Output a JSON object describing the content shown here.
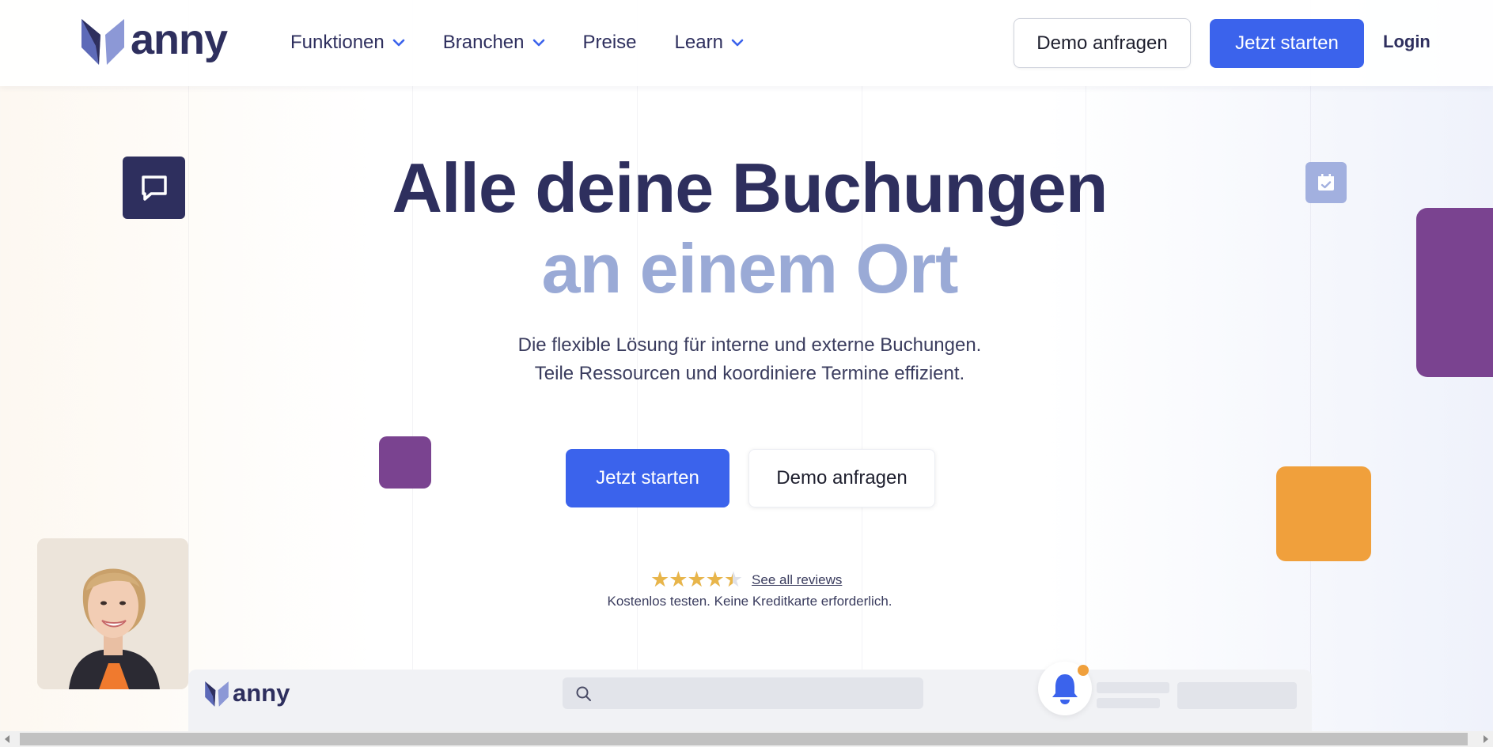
{
  "header": {
    "logo_text": "anny",
    "nav": [
      {
        "label": "Funktionen",
        "has_dropdown": true
      },
      {
        "label": "Branchen",
        "has_dropdown": true
      },
      {
        "label": "Preise",
        "has_dropdown": false
      },
      {
        "label": "Learn",
        "has_dropdown": true
      }
    ],
    "demo_label": "Demo anfragen",
    "start_label": "Jetzt starten",
    "login_label": "Login"
  },
  "hero": {
    "title_line1": "Alle deine Buchungen",
    "title_line2": "an einem Ort",
    "subtitle_line1": "Die flexible Lösung für interne und externe Buchungen.",
    "subtitle_line2": "Teile Ressourcen und koordiniere Termine effizient.",
    "primary_cta": "Jetzt starten",
    "secondary_cta": "Demo anfragen",
    "rating": {
      "stars_glyphs": "★★★★★",
      "value": 4.5,
      "max": 5,
      "reviews_link": "See all reviews"
    },
    "free_note": "Kostenlos testen. Keine Kreditkarte erforderlich."
  },
  "decor": {
    "chat_icon": "chat-bubble-icon",
    "calendar_icon": "calendar-check-icon",
    "colors": {
      "navy": "#2e2f5e",
      "purple": "#7a4390",
      "orange": "#f0a03c",
      "blue": "#3b63ec",
      "lavender": "#9aaad6"
    }
  },
  "app_preview": {
    "logo_text": "anny",
    "search_icon": "search-icon",
    "bell_icon": "bell-icon"
  }
}
